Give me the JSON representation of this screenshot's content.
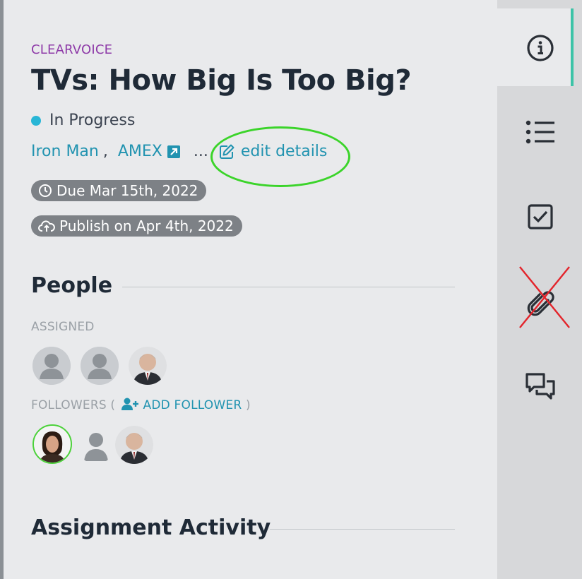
{
  "header": {
    "brand": "CLEARVOICE",
    "title": "TVs: How Big Is Too Big?"
  },
  "status": {
    "label": "In Progress",
    "color": "#28b6d6"
  },
  "links": {
    "person": "Iron Man",
    "separator": ",",
    "client": "AMEX",
    "ellipsis": "...",
    "edit_label": "edit details"
  },
  "badges": {
    "due": "Due Mar 15th, 2022",
    "publish": "Publish on Apr 4th, 2022"
  },
  "people": {
    "heading": "People",
    "assigned_label": "ASSIGNED",
    "followers_label": "FOLLOWERS (",
    "add_follower": "ADD FOLLOWER",
    "followers_close": ")"
  },
  "activity": {
    "heading": "Assignment Activity"
  },
  "sidebar": {
    "items": [
      {
        "icon": "info-icon"
      },
      {
        "icon": "list-icon"
      },
      {
        "icon": "checkbox-icon"
      },
      {
        "icon": "paperclip-icon"
      },
      {
        "icon": "comments-icon"
      }
    ]
  },
  "colors": {
    "accent": "#2193b0",
    "brand": "#8e3aa8",
    "active_tab": "#3cc3a7",
    "annotation_circle": "#3bd42a",
    "annotation_cross": "#e3242b"
  }
}
